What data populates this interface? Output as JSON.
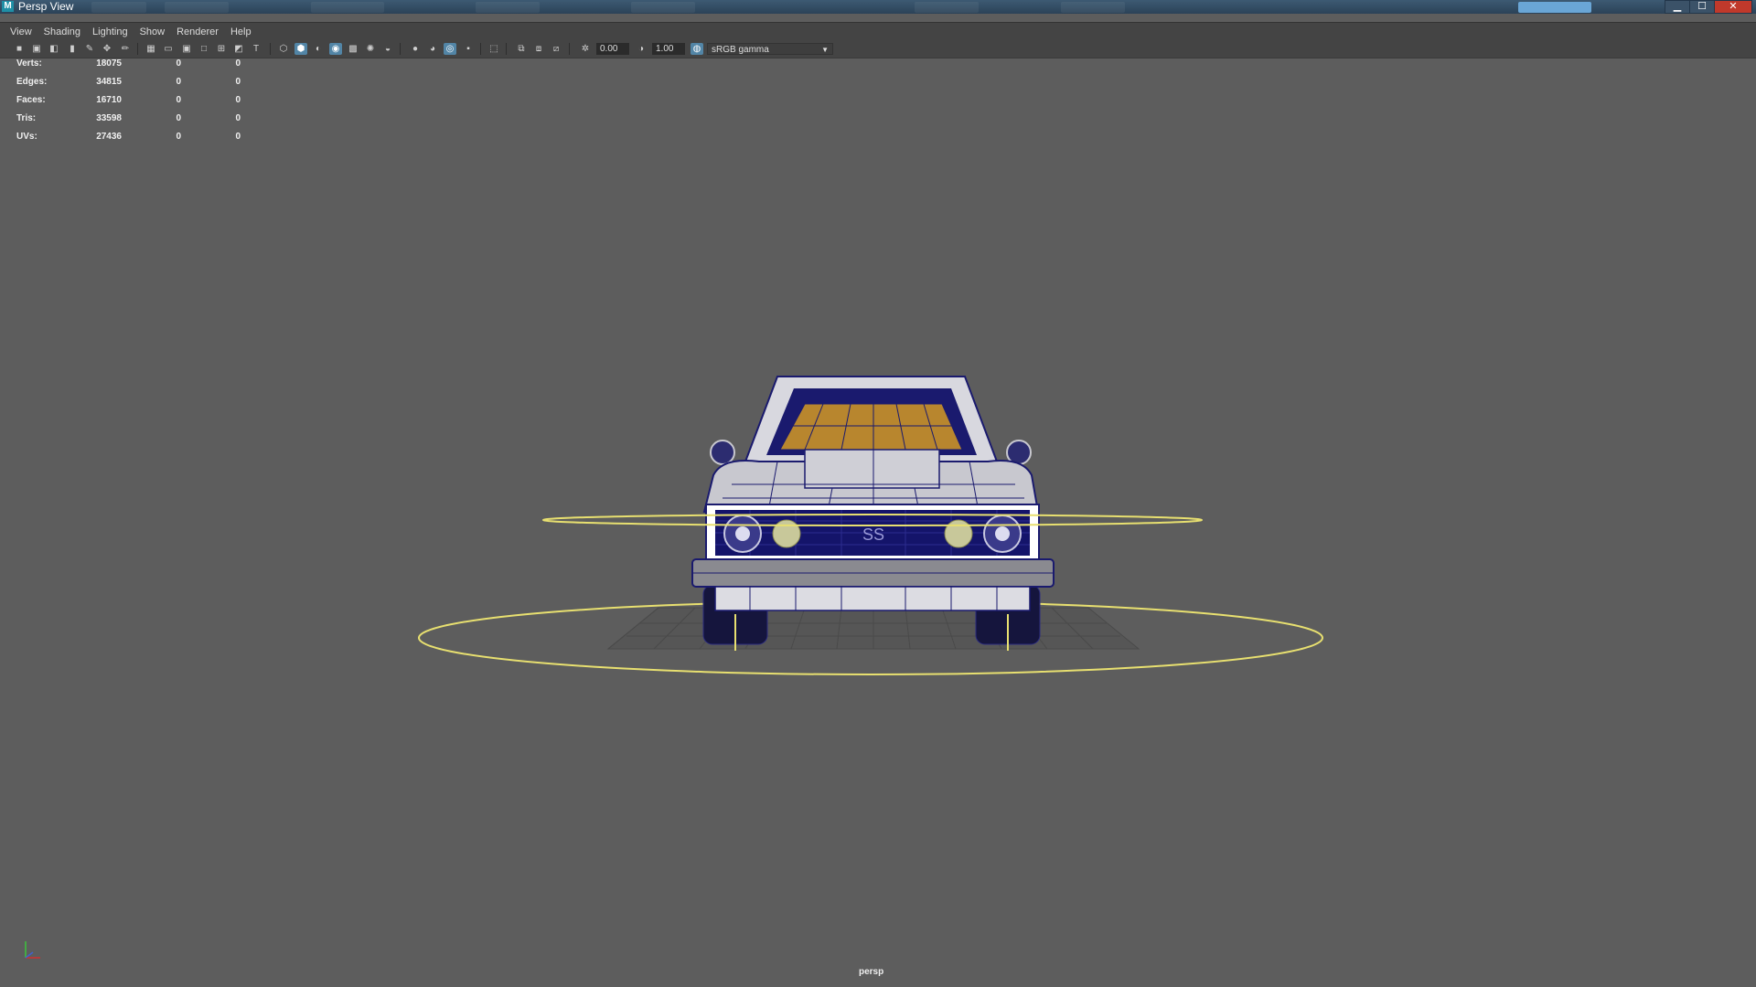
{
  "window": {
    "app_icon": "M",
    "title": "Persp View"
  },
  "menu": [
    "View",
    "Shading",
    "Lighting",
    "Show",
    "Renderer",
    "Help"
  ],
  "toolbar": {
    "exposure": "0.00",
    "gamma": "1.00",
    "colorspace": "sRGB gamma"
  },
  "hud": [
    {
      "label": "Verts:",
      "values": [
        "18075",
        "0",
        "0"
      ]
    },
    {
      "label": "Edges:",
      "values": [
        "34815",
        "0",
        "0"
      ]
    },
    {
      "label": "Faces:",
      "values": [
        "16710",
        "0",
        "0"
      ]
    },
    {
      "label": "Tris:",
      "values": [
        "33598",
        "0",
        "0"
      ]
    },
    {
      "label": "UVs:",
      "values": [
        "27436",
        "0",
        "0"
      ]
    }
  ],
  "viewport": {
    "camera": "persp",
    "badge_text": "SS",
    "colors": {
      "background": "#5d5d5d",
      "car_body": "#c8c8cf",
      "wire": "#1a1a6e",
      "selection": "#e8e070",
      "interior": "#b8862e",
      "grid": "#4a4a4a"
    }
  }
}
